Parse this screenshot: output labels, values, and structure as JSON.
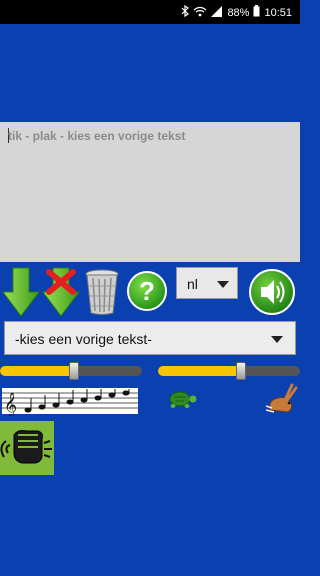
{
  "status_bar": {
    "battery": "88%",
    "time": "10:51",
    "icons": [
      "bluetooth-icon",
      "wifi-icon",
      "signal-icon",
      "battery-icon"
    ]
  },
  "text_input": {
    "placeholder": "tik - plak - kies een vorige tekst"
  },
  "toolbar": {
    "icons": [
      "arrow-down-icon",
      "clear-text-icon",
      "trash-icon",
      "help-icon",
      "speaker-icon"
    ]
  },
  "language_select": {
    "value": "nl"
  },
  "previous_text_select": {
    "value": "-kies een vorige tekst-"
  },
  "sliders": {
    "pitch_level": 0.52,
    "speed_level": 0.58,
    "pitch_icon": "music-notes-icon",
    "slow_icon": "turtle-icon",
    "fast_icon": "hare-icon"
  },
  "extra_button": {
    "icon": "fist-icon"
  },
  "colors": {
    "background": "#0a40b0",
    "slider_fill": "#f7c600",
    "green": "#6cc033"
  }
}
